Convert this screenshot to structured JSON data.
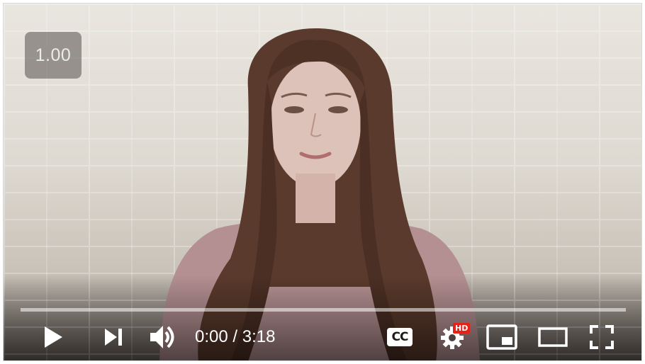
{
  "player": {
    "speed_badge": "1.00",
    "time": {
      "current": "0:00",
      "separator": " / ",
      "duration": "3:18"
    },
    "progress_fraction": 0.0,
    "controls": {
      "play_icon": "play-icon",
      "next_icon": "next-icon",
      "volume_icon": "volume-icon",
      "captions_icon": "cc-icon",
      "captions_label": "CC",
      "settings_icon": "gear-icon",
      "hd_badge": "HD",
      "miniplayer_icon": "miniplayer-icon",
      "theater_icon": "theater-icon",
      "fullscreen_icon": "fullscreen-icon"
    },
    "colors": {
      "hd_badge": "#e62117",
      "progress_played": "#ff0000"
    }
  }
}
